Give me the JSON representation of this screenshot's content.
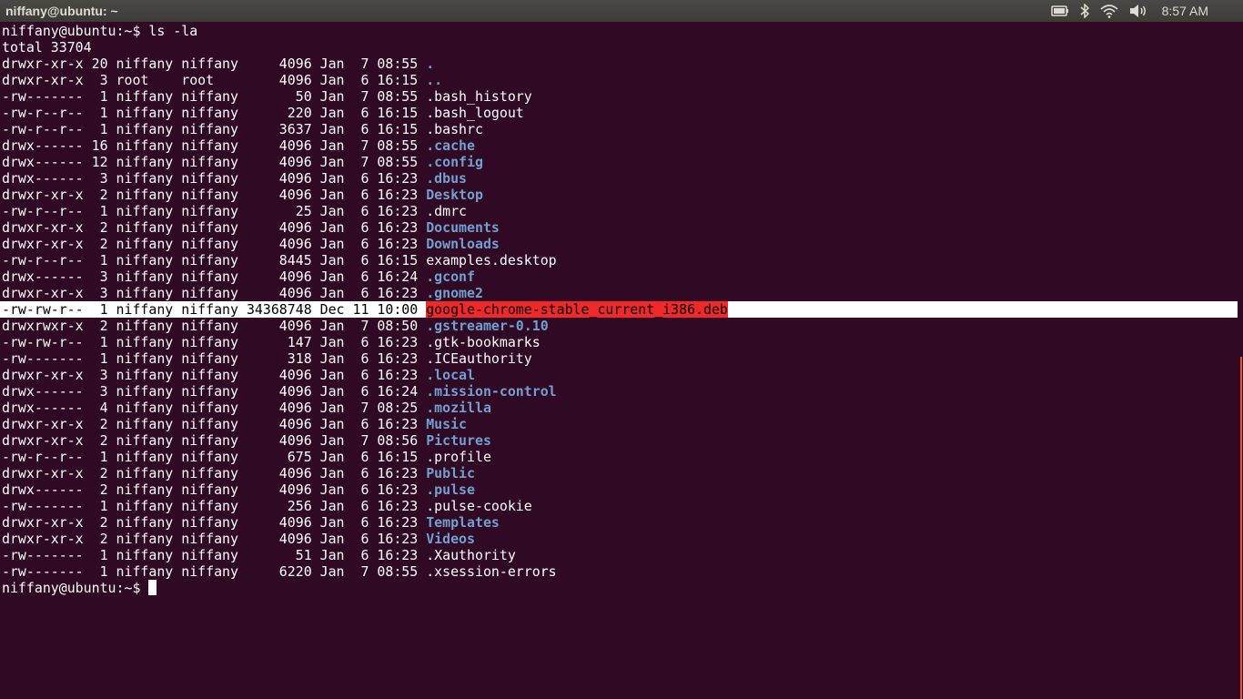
{
  "window": {
    "title": "niffany@ubuntu: ~"
  },
  "tray": {
    "icons": [
      "battery-icon",
      "bluetooth-icon",
      "wifi-icon",
      "volume-icon"
    ],
    "clock": "8:57 AM"
  },
  "terminal": {
    "prompt": "niffany@ubuntu:~$ ",
    "command": "ls -la",
    "total": "total 33704",
    "rows": [
      {
        "meta": "drwxr-xr-x 20 niffany niffany     4096 Jan  7 08:55 ",
        "name": ".",
        "dir": true
      },
      {
        "meta": "drwxr-xr-x  3 root    root        4096 Jan  6 16:15 ",
        "name": "..",
        "dir": true
      },
      {
        "meta": "-rw-------  1 niffany niffany       50 Jan  7 08:55 ",
        "name": ".bash_history",
        "dir": false
      },
      {
        "meta": "-rw-r--r--  1 niffany niffany      220 Jan  6 16:15 ",
        "name": ".bash_logout",
        "dir": false
      },
      {
        "meta": "-rw-r--r--  1 niffany niffany     3637 Jan  6 16:15 ",
        "name": ".bashrc",
        "dir": false
      },
      {
        "meta": "drwx------ 16 niffany niffany     4096 Jan  7 08:55 ",
        "name": ".cache",
        "dir": true
      },
      {
        "meta": "drwx------ 12 niffany niffany     4096 Jan  7 08:55 ",
        "name": ".config",
        "dir": true
      },
      {
        "meta": "drwx------  3 niffany niffany     4096 Jan  6 16:23 ",
        "name": ".dbus",
        "dir": true
      },
      {
        "meta": "drwxr-xr-x  2 niffany niffany     4096 Jan  6 16:23 ",
        "name": "Desktop",
        "dir": true
      },
      {
        "meta": "-rw-r--r--  1 niffany niffany       25 Jan  6 16:23 ",
        "name": ".dmrc",
        "dir": false
      },
      {
        "meta": "drwxr-xr-x  2 niffany niffany     4096 Jan  6 16:23 ",
        "name": "Documents",
        "dir": true
      },
      {
        "meta": "drwxr-xr-x  2 niffany niffany     4096 Jan  6 16:23 ",
        "name": "Downloads",
        "dir": true
      },
      {
        "meta": "-rw-r--r--  1 niffany niffany     8445 Jan  6 16:15 ",
        "name": "examples.desktop",
        "dir": false
      },
      {
        "meta": "drwx------  3 niffany niffany     4096 Jan  6 16:24 ",
        "name": ".gconf",
        "dir": true
      },
      {
        "meta": "drwxr-xr-x  3 niffany niffany     4096 Jan  6 16:23 ",
        "name": ".gnome2",
        "dir": true
      },
      {
        "meta": "-rw-rw-r--  1 niffany niffany 34368748 Dec 11 10:00 ",
        "name": "google-chrome-stable_current_i386.deb",
        "dir": false,
        "highlight": true
      },
      {
        "meta": "drwxrwxr-x  2 niffany niffany     4096 Jan  7 08:50 ",
        "name": ".gstreamer-0.10",
        "dir": true
      },
      {
        "meta": "-rw-rw-r--  1 niffany niffany      147 Jan  6 16:23 ",
        "name": ".gtk-bookmarks",
        "dir": false
      },
      {
        "meta": "-rw-------  1 niffany niffany      318 Jan  6 16:23 ",
        "name": ".ICEauthority",
        "dir": false
      },
      {
        "meta": "drwxr-xr-x  3 niffany niffany     4096 Jan  6 16:23 ",
        "name": ".local",
        "dir": true
      },
      {
        "meta": "drwx------  3 niffany niffany     4096 Jan  6 16:24 ",
        "name": ".mission-control",
        "dir": true
      },
      {
        "meta": "drwx------  4 niffany niffany     4096 Jan  7 08:25 ",
        "name": ".mozilla",
        "dir": true
      },
      {
        "meta": "drwxr-xr-x  2 niffany niffany     4096 Jan  6 16:23 ",
        "name": "Music",
        "dir": true
      },
      {
        "meta": "drwxr-xr-x  2 niffany niffany     4096 Jan  7 08:56 ",
        "name": "Pictures",
        "dir": true
      },
      {
        "meta": "-rw-r--r--  1 niffany niffany      675 Jan  6 16:15 ",
        "name": ".profile",
        "dir": false
      },
      {
        "meta": "drwxr-xr-x  2 niffany niffany     4096 Jan  6 16:23 ",
        "name": "Public",
        "dir": true
      },
      {
        "meta": "drwx------  2 niffany niffany     4096 Jan  6 16:23 ",
        "name": ".pulse",
        "dir": true
      },
      {
        "meta": "-rw-------  1 niffany niffany      256 Jan  6 16:23 ",
        "name": ".pulse-cookie",
        "dir": false
      },
      {
        "meta": "drwxr-xr-x  2 niffany niffany     4096 Jan  6 16:23 ",
        "name": "Templates",
        "dir": true
      },
      {
        "meta": "drwxr-xr-x  2 niffany niffany     4096 Jan  6 16:23 ",
        "name": "Videos",
        "dir": true
      },
      {
        "meta": "-rw-------  1 niffany niffany       51 Jan  6 16:23 ",
        "name": ".Xauthority",
        "dir": false
      },
      {
        "meta": "-rw-------  1 niffany niffany     6220 Jan  7 08:55 ",
        "name": ".xsession-errors",
        "dir": false
      }
    ]
  },
  "colors": {
    "background": "#300a24",
    "directory": "#729fcf",
    "highlight_name": "#ef2929",
    "scroll_marker": "#e95420"
  }
}
